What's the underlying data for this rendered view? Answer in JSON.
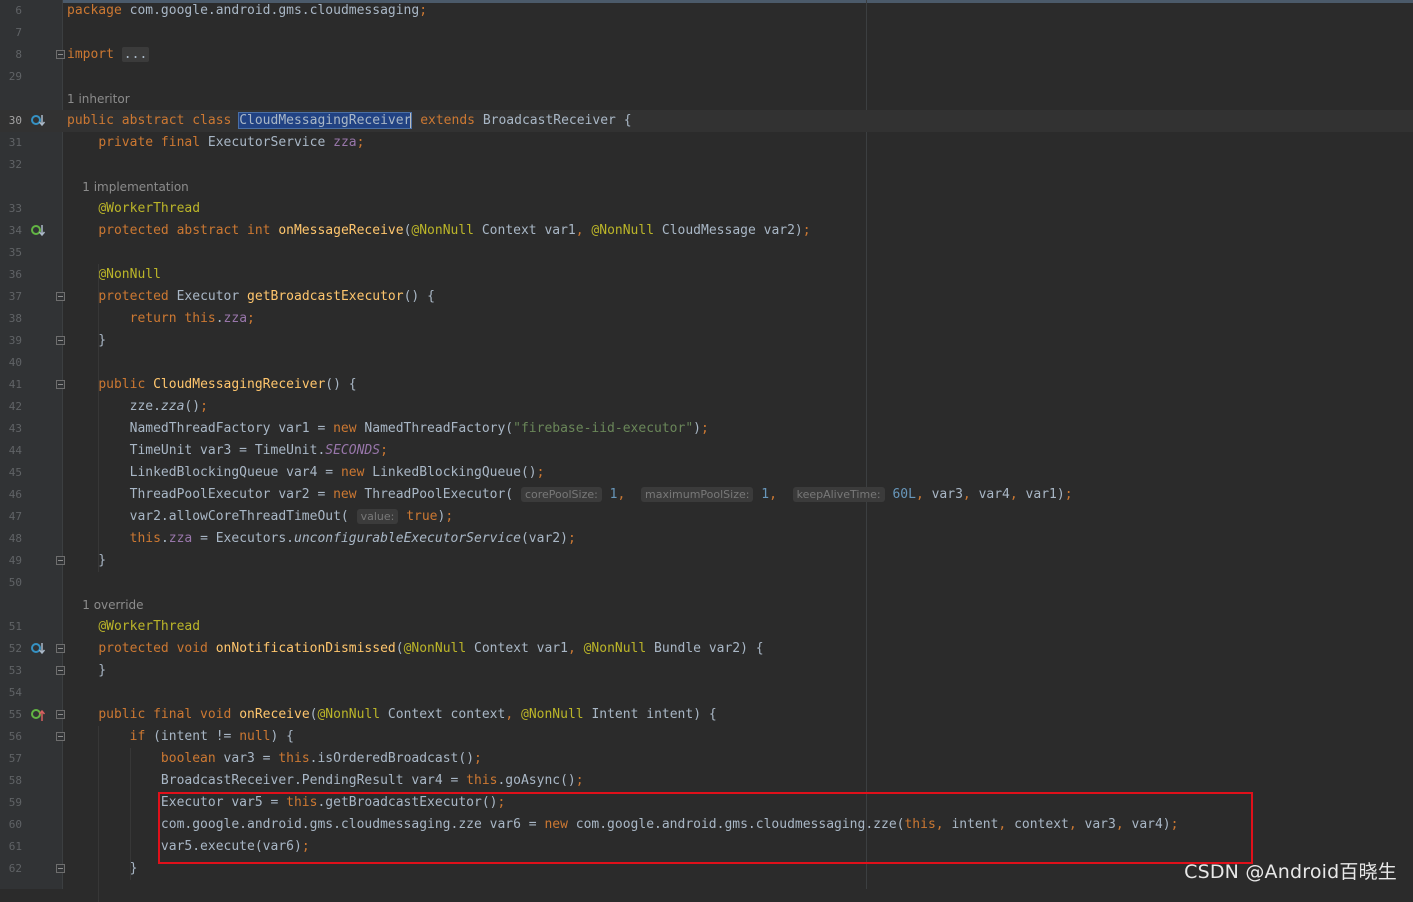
{
  "editor": {
    "lines": [
      {
        "num": "6",
        "segments": [
          {
            "t": "package ",
            "c": "kw"
          },
          {
            "t": "com.google.android.gms.cloudmessaging"
          },
          {
            "t": ";",
            "c": "kw"
          }
        ]
      },
      {
        "num": "7",
        "segments": []
      },
      {
        "num": "8",
        "segments": [
          {
            "t": "import ",
            "c": "kw"
          },
          {
            "t": "...",
            "c": "fold-dots"
          }
        ]
      },
      {
        "num": "29",
        "segments": []
      },
      {
        "hint": "1 inheritor"
      },
      {
        "num": "30",
        "current": true,
        "segments": [
          {
            "t": "public abstract class ",
            "c": "kw"
          },
          {
            "t": "CloudMessagingReceiver",
            "c": "sel"
          },
          {
            "t": "",
            "c": "caret"
          },
          {
            "t": " extends ",
            "c": "kw"
          },
          {
            "t": "BroadcastReceiver {"
          }
        ]
      },
      {
        "num": "31",
        "segments": [
          {
            "t": "    "
          },
          {
            "t": "private final ",
            "c": "kw"
          },
          {
            "t": "ExecutorService "
          },
          {
            "t": "zza",
            "c": "fld"
          },
          {
            "t": ";",
            "c": "kw"
          }
        ]
      },
      {
        "num": "32",
        "segments": []
      },
      {
        "hint": "    1 implementation"
      },
      {
        "num": "33",
        "segments": [
          {
            "t": "    "
          },
          {
            "t": "@WorkerThread",
            "c": "ann"
          }
        ]
      },
      {
        "num": "34",
        "segments": [
          {
            "t": "    "
          },
          {
            "t": "protected abstract int ",
            "c": "kw"
          },
          {
            "t": "onMessageReceive",
            "c": "fn"
          },
          {
            "t": "("
          },
          {
            "t": "@NonNull",
            "c": "ann"
          },
          {
            "t": " Context var1"
          },
          {
            "t": ", ",
            "c": "kw"
          },
          {
            "t": "@NonNull",
            "c": "ann"
          },
          {
            "t": " CloudMessage var2)"
          },
          {
            "t": ";",
            "c": "kw"
          }
        ]
      },
      {
        "num": "35",
        "segments": []
      },
      {
        "num": "36",
        "segments": [
          {
            "t": "    "
          },
          {
            "t": "@NonNull",
            "c": "ann"
          }
        ]
      },
      {
        "num": "37",
        "segments": [
          {
            "t": "    "
          },
          {
            "t": "protected ",
            "c": "kw"
          },
          {
            "t": "Executor "
          },
          {
            "t": "getBroadcastExecutor",
            "c": "fn"
          },
          {
            "t": "() {"
          }
        ]
      },
      {
        "num": "38",
        "segments": [
          {
            "t": "        "
          },
          {
            "t": "return this",
            "c": "kw"
          },
          {
            "t": "."
          },
          {
            "t": "zza",
            "c": "fld"
          },
          {
            "t": ";",
            "c": "kw"
          }
        ]
      },
      {
        "num": "39",
        "segments": [
          {
            "t": "    }"
          }
        ]
      },
      {
        "num": "40",
        "segments": []
      },
      {
        "num": "41",
        "segments": [
          {
            "t": "    "
          },
          {
            "t": "public ",
            "c": "kw"
          },
          {
            "t": "CloudMessagingReceiver",
            "c": "fn"
          },
          {
            "t": "() {"
          }
        ]
      },
      {
        "num": "42",
        "segments": [
          {
            "t": "        zze."
          },
          {
            "t": "zza",
            "c": "it"
          },
          {
            "t": "()"
          },
          {
            "t": ";",
            "c": "kw"
          }
        ]
      },
      {
        "num": "43",
        "segments": [
          {
            "t": "        NamedThreadFactory var1 = "
          },
          {
            "t": "new ",
            "c": "kw"
          },
          {
            "t": "NamedThreadFactory("
          },
          {
            "t": "\"firebase-iid-executor\"",
            "c": "str"
          },
          {
            "t": ")"
          },
          {
            "t": ";",
            "c": "kw"
          }
        ]
      },
      {
        "num": "44",
        "segments": [
          {
            "t": "        TimeUnit var3 = TimeUnit."
          },
          {
            "t": "SECONDS",
            "c": "itfld"
          },
          {
            "t": ";",
            "c": "kw"
          }
        ]
      },
      {
        "num": "45",
        "segments": [
          {
            "t": "        LinkedBlockingQueue var4 = "
          },
          {
            "t": "new ",
            "c": "kw"
          },
          {
            "t": "LinkedBlockingQueue()"
          },
          {
            "t": ";",
            "c": "kw"
          }
        ]
      },
      {
        "num": "46",
        "segments": [
          {
            "t": "        ThreadPoolExecutor var2 = "
          },
          {
            "t": "new ",
            "c": "kw"
          },
          {
            "t": "ThreadPoolExecutor( "
          },
          {
            "t": "corePoolSize:",
            "c": "inlay"
          },
          {
            "t": " "
          },
          {
            "t": "1",
            "c": "num"
          },
          {
            "t": ", ",
            "c": "kw"
          },
          {
            "t": " "
          },
          {
            "t": "maximumPoolSize:",
            "c": "inlay"
          },
          {
            "t": " "
          },
          {
            "t": "1",
            "c": "num"
          },
          {
            "t": ", ",
            "c": "kw"
          },
          {
            "t": " "
          },
          {
            "t": "keepAliveTime:",
            "c": "inlay"
          },
          {
            "t": " "
          },
          {
            "t": "60L",
            "c": "num"
          },
          {
            "t": ", ",
            "c": "kw"
          },
          {
            "t": "var3"
          },
          {
            "t": ", ",
            "c": "kw"
          },
          {
            "t": "var4"
          },
          {
            "t": ", ",
            "c": "kw"
          },
          {
            "t": "var1)"
          },
          {
            "t": ";",
            "c": "kw"
          }
        ]
      },
      {
        "num": "47",
        "segments": [
          {
            "t": "        var2.allowCoreThreadTimeOut( "
          },
          {
            "t": "value:",
            "c": "inlay"
          },
          {
            "t": " "
          },
          {
            "t": "true",
            "c": "kw"
          },
          {
            "t": ")"
          },
          {
            "t": ";",
            "c": "kw"
          }
        ]
      },
      {
        "num": "48",
        "segments": [
          {
            "t": "        "
          },
          {
            "t": "this",
            "c": "kw"
          },
          {
            "t": "."
          },
          {
            "t": "zza",
            "c": "fld"
          },
          {
            "t": " = Executors."
          },
          {
            "t": "unconfigurableExecutorService",
            "c": "it"
          },
          {
            "t": "(var2)"
          },
          {
            "t": ";",
            "c": "kw"
          }
        ]
      },
      {
        "num": "49",
        "segments": [
          {
            "t": "    }"
          }
        ]
      },
      {
        "num": "50",
        "segments": []
      },
      {
        "hint": "    1 override"
      },
      {
        "num": "51",
        "segments": [
          {
            "t": "    "
          },
          {
            "t": "@WorkerThread",
            "c": "ann"
          }
        ]
      },
      {
        "num": "52",
        "segments": [
          {
            "t": "    "
          },
          {
            "t": "protected void ",
            "c": "kw"
          },
          {
            "t": "onNotificationDismissed",
            "c": "fn"
          },
          {
            "t": "("
          },
          {
            "t": "@NonNull",
            "c": "ann"
          },
          {
            "t": " Context var1"
          },
          {
            "t": ", ",
            "c": "kw"
          },
          {
            "t": "@NonNull",
            "c": "ann"
          },
          {
            "t": " Bundle var2) {"
          }
        ]
      },
      {
        "num": "53",
        "segments": [
          {
            "t": "    }"
          }
        ]
      },
      {
        "num": "54",
        "segments": []
      },
      {
        "num": "55",
        "segments": [
          {
            "t": "    "
          },
          {
            "t": "public final void ",
            "c": "kw"
          },
          {
            "t": "onReceive",
            "c": "fn"
          },
          {
            "t": "("
          },
          {
            "t": "@NonNull",
            "c": "ann"
          },
          {
            "t": " Context context"
          },
          {
            "t": ", ",
            "c": "kw"
          },
          {
            "t": "@NonNull",
            "c": "ann"
          },
          {
            "t": " Intent intent) {"
          }
        ]
      },
      {
        "num": "56",
        "segments": [
          {
            "t": "        "
          },
          {
            "t": "if ",
            "c": "kw"
          },
          {
            "t": "(intent != "
          },
          {
            "t": "null",
            "c": "kw"
          },
          {
            "t": ") {"
          }
        ]
      },
      {
        "num": "57",
        "segments": [
          {
            "t": "            "
          },
          {
            "t": "boolean ",
            "c": "kw"
          },
          {
            "t": "var3 = "
          },
          {
            "t": "this",
            "c": "kw"
          },
          {
            "t": ".isOrderedBroadcast()"
          },
          {
            "t": ";",
            "c": "kw"
          }
        ]
      },
      {
        "num": "58",
        "segments": [
          {
            "t": "            BroadcastReceiver.PendingResult var4 = "
          },
          {
            "t": "this",
            "c": "kw"
          },
          {
            "t": ".goAsync()"
          },
          {
            "t": ";",
            "c": "kw"
          }
        ]
      },
      {
        "num": "59",
        "segments": [
          {
            "t": "            Executor var5 = "
          },
          {
            "t": "this",
            "c": "kw"
          },
          {
            "t": ".getBroadcastExecutor()"
          },
          {
            "t": ";",
            "c": "kw"
          }
        ]
      },
      {
        "num": "60",
        "segments": [
          {
            "t": "            com.google.android.gms.cloudmessaging.zze var6 = "
          },
          {
            "t": "new ",
            "c": "kw"
          },
          {
            "t": "com.google.android.gms.cloudmessaging.zze("
          },
          {
            "t": "this",
            "c": "kw"
          },
          {
            "t": ", ",
            "c": "kw"
          },
          {
            "t": "intent"
          },
          {
            "t": ", ",
            "c": "kw"
          },
          {
            "t": "context"
          },
          {
            "t": ", ",
            "c": "kw"
          },
          {
            "t": "var3"
          },
          {
            "t": ", ",
            "c": "kw"
          },
          {
            "t": "var4)"
          },
          {
            "t": ";",
            "c": "kw"
          }
        ]
      },
      {
        "num": "61",
        "segments": [
          {
            "t": "            var5.execute(var6)"
          },
          {
            "t": ";",
            "c": "kw"
          }
        ]
      },
      {
        "num": "62",
        "segments": [
          {
            "t": "        }"
          }
        ]
      }
    ],
    "gutter_icons": {
      "30": "overridden-method-icon",
      "34": "implemented-method-icon",
      "52": "overridden-method-icon",
      "55": "overriding-method-icon"
    },
    "fold_lines": [
      "8",
      "37",
      "39",
      "41",
      "49",
      "52",
      "53",
      "55",
      "56",
      "62"
    ]
  },
  "watermark": "CSDN @Android百晓生",
  "colors": {
    "background": "#2b2b2b",
    "keyword": "#cc7832",
    "string": "#6a8759",
    "annotation": "#bbb529",
    "field": "#9876aa",
    "method": "#ffc66d",
    "highlight_box": "#e0101a",
    "selection": "#214283"
  }
}
